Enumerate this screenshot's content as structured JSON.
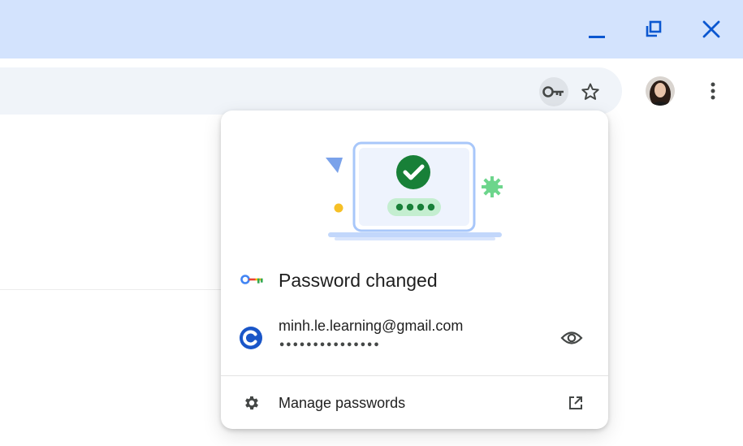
{
  "window": {
    "controls": [
      {
        "name": "minimize-button",
        "icon": "minimize-icon"
      },
      {
        "name": "restore-button",
        "icon": "restore-icon"
      },
      {
        "name": "close-button",
        "icon": "close-icon"
      }
    ]
  },
  "toolbar": {
    "icons": [
      "key-icon",
      "star-icon",
      "avatar",
      "more-vert-icon"
    ]
  },
  "password_bubble": {
    "title": "Password changed",
    "credential": {
      "username": "minh.le.learning@gmail.com",
      "password_mask": "•••••••••••••••",
      "site_icon": "site-c-icon"
    },
    "manage_label": "Manage passwords"
  },
  "colors": {
    "titlebar": "#d3e3fd",
    "omnibox": "#f0f4f9",
    "accent_blue": "#0b57d0",
    "success_green": "#188038",
    "control_icon": "#0b57d0"
  }
}
